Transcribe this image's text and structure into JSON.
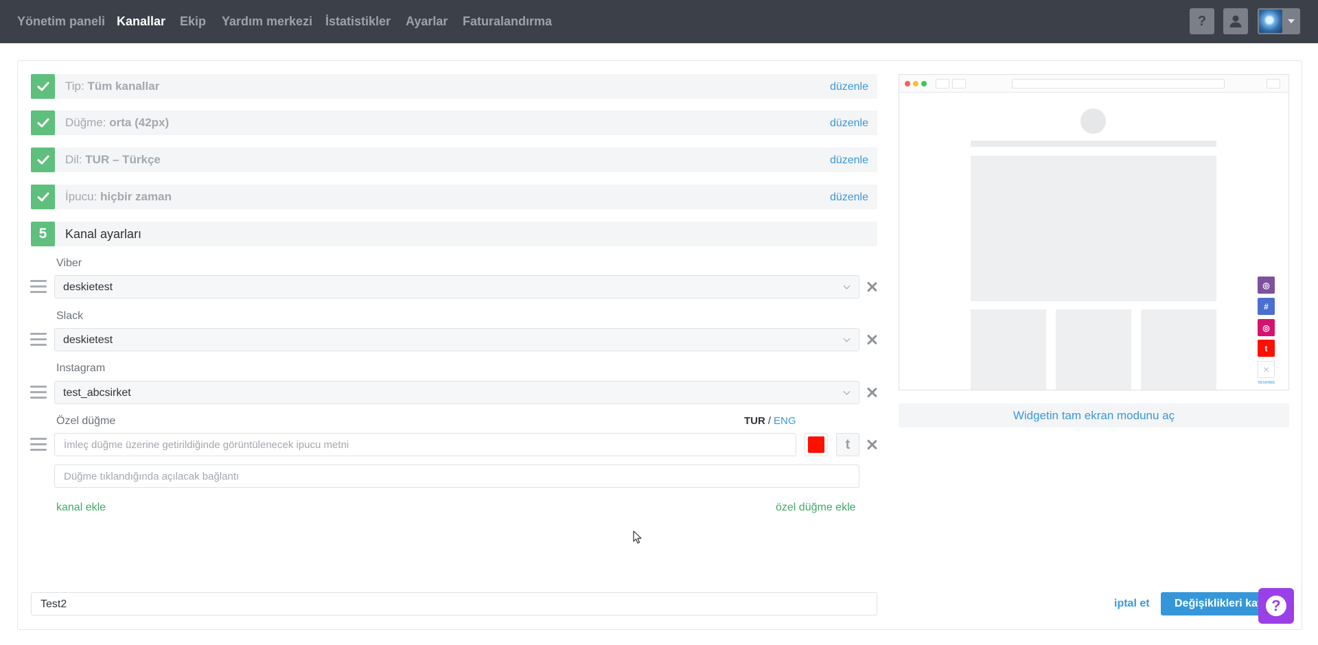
{
  "nav": {
    "items": [
      "Yönetim paneli",
      "Kanallar",
      "Ekip",
      "Yardım merkezi",
      "İstatistikler",
      "Ayarlar",
      "Faturalandırma"
    ],
    "active": "Kanallar",
    "help_label": "?"
  },
  "steps": [
    {
      "label": "Tip:",
      "value": "Tüm kanallar",
      "edit": "düzenle"
    },
    {
      "label": "Düğme:",
      "value": "orta (42px)",
      "edit": "düzenle"
    },
    {
      "label": "Dil:",
      "value": "TUR – Türkçe",
      "edit": "düzenle"
    },
    {
      "label": "İpucu:",
      "value": "hiçbir zaman",
      "edit": "düzenle"
    }
  ],
  "current_step": {
    "number": "5",
    "title": "Kanal ayarları"
  },
  "channels": [
    {
      "label": "Viber",
      "value": "deskietest"
    },
    {
      "label": "Slack",
      "value": "deskietest"
    },
    {
      "label": "Instagram",
      "value": "test_abcsirket"
    }
  ],
  "custom_button": {
    "label": "Özel düğme",
    "lang_current": "TUR",
    "lang_sep": "/",
    "lang_alt": "ENG",
    "tooltip_placeholder": "İmleç düğme üzerine getirildiğinde görüntülenecek ipucu metni",
    "link_placeholder": "Düğme tıklandığında açılacak bağlantı",
    "color": "#ff0f00",
    "icon_glyph": "t"
  },
  "add_channel": "kanal ekle",
  "add_custom_button": "özel düğme ekle",
  "widget_name": "Test2",
  "fullscreen_label": "Widgetin tam ekran modunu aç",
  "cancel_label": "iptal et",
  "save_label": "Değişiklikleri kaydet",
  "preview": {
    "icons": [
      {
        "name": "viber",
        "color": "#7d519c",
        "glyph": "◎"
      },
      {
        "name": "slack",
        "color": "#4a6fd1",
        "glyph": "#"
      },
      {
        "name": "instagram",
        "color": "#d6126e",
        "glyph": "◎"
      },
      {
        "name": "tumblr",
        "color": "#ff0f00",
        "glyph": "t"
      }
    ],
    "close_glyph": "✕",
    "brand": "DESKIBEE"
  }
}
